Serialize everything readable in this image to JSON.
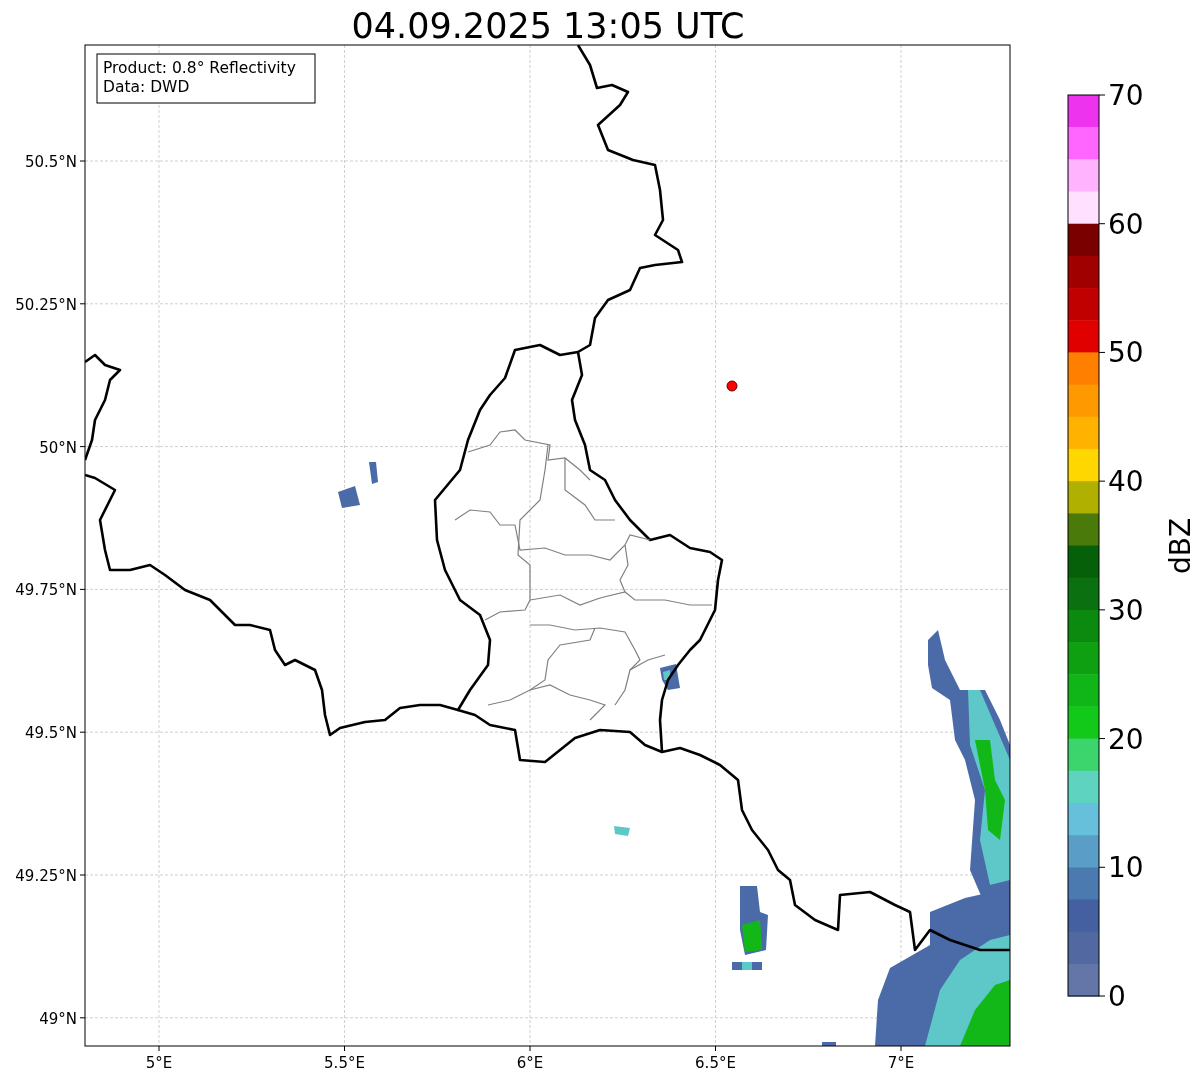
{
  "title": "04.09.2025 13:05 UTC",
  "info_box": [
    "Product: 0.8° Reflectivity",
    "Data: DWD"
  ],
  "map": {
    "lat_labels": [
      "50.5°N",
      "50.25°N",
      "50°N",
      "49.75°N",
      "49.5°N",
      "49.25°N",
      "49°N"
    ],
    "lon_labels": [
      "5°E",
      "5.5°E",
      "6°E",
      "6.5°E",
      "7°E"
    ]
  },
  "colorbar": {
    "label": "dBZ",
    "ticks": [
      "70",
      "60",
      "50",
      "40",
      "30",
      "20",
      "10",
      "0"
    ],
    "bins": [
      {
        "color": "#ee33ee"
      },
      {
        "color": "#ff66ff"
      },
      {
        "color": "#ffb3ff"
      },
      {
        "color": "#ffe0ff"
      },
      {
        "color": "#7a0000"
      },
      {
        "color": "#a00000"
      },
      {
        "color": "#c00000"
      },
      {
        "color": "#e00000"
      },
      {
        "color": "#ff8000"
      },
      {
        "color": "#ff9900"
      },
      {
        "color": "#ffb300"
      },
      {
        "color": "#ffd700"
      },
      {
        "color": "#b0b000"
      },
      {
        "color": "#4a7a0a"
      },
      {
        "color": "#06600a"
      },
      {
        "color": "#0a7010"
      },
      {
        "color": "#0c8a10"
      },
      {
        "color": "#0ea010"
      },
      {
        "color": "#10b518"
      },
      {
        "color": "#12c818"
      },
      {
        "color": "#3cd46c"
      },
      {
        "color": "#5ed4c0"
      },
      {
        "color": "#66c0dc"
      },
      {
        "color": "#5a9ec8"
      },
      {
        "color": "#4a7ab0"
      },
      {
        "color": "#4460a0"
      },
      {
        "color": "#5268a0"
      },
      {
        "color": "#6476a8"
      }
    ]
  }
}
